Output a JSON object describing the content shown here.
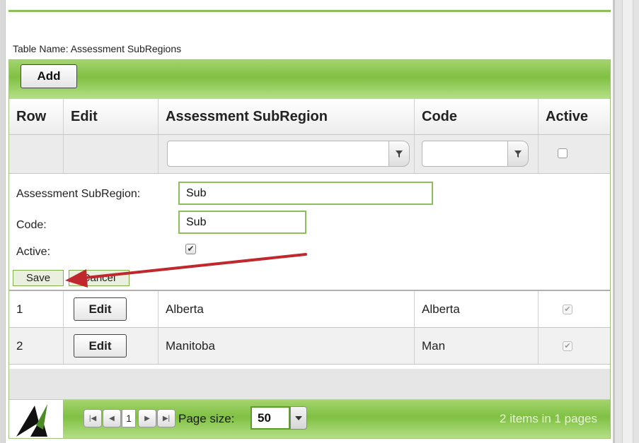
{
  "table": {
    "name_label": "Table Name: Assessment SubRegions"
  },
  "toolbar": {
    "add_label": "Add"
  },
  "columns": {
    "row": "Row",
    "edit": "Edit",
    "subregion": "Assessment SubRegion",
    "code": "Code",
    "active": "Active"
  },
  "filter": {
    "subregion_value": "",
    "code_value": "",
    "active_checked": false,
    "icon": "funnel-icon"
  },
  "edit_form": {
    "subregion_label": "Assessment SubRegion:",
    "subregion_value": "Sub",
    "code_label": "Code:",
    "code_value": "Sub",
    "active_label": "Active:",
    "active_checked": true,
    "save_label": "Save",
    "cancel_label": "Cancel"
  },
  "rows": [
    {
      "row": "1",
      "edit_label": "Edit",
      "subregion": "Alberta",
      "code": "Alberta",
      "active": true
    },
    {
      "row": "2",
      "edit_label": "Edit",
      "subregion": "Manitoba",
      "code": "Man",
      "active": true
    }
  ],
  "pager": {
    "first_icon": "first-page-icon",
    "prev_icon": "previous-page-icon",
    "current_page": "1",
    "next_icon": "next-page-icon",
    "last_icon": "last-page-icon",
    "page_size_label": "Page size:",
    "page_size_value": "50",
    "info_text": "2 items in 1 pages"
  },
  "colors": {
    "accent_green": "#80c043",
    "annotation_arrow": "#c0282d"
  }
}
